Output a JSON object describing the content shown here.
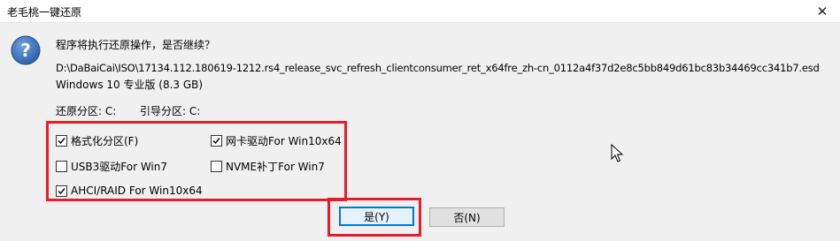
{
  "window": {
    "title": "老毛桃一键还原",
    "close_glyph": "✕"
  },
  "dialog": {
    "question": "程序将执行还原操作，是否继续？",
    "image_path": "D:\\DaBaiCai\\ISO\\17134.112.180619-1212.rs4_release_svc_refresh_clientconsumer_ret_x64fre_zh-cn_0112a4f37d2e8c5bb849d61bc83b34469cc341b7.esd",
    "image_info": "Windows 10 专业版 (8.3 GB)",
    "restore_partition": "还原分区: C:",
    "boot_partition": "引导分区: C:"
  },
  "options": [
    {
      "label": "格式化分区(F)",
      "checked": true
    },
    {
      "label": "网卡驱动For Win10x64",
      "checked": true
    },
    {
      "label": "USB3驱动For Win7",
      "checked": false
    },
    {
      "label": "NVME补丁For Win7",
      "checked": false
    },
    {
      "label": "AHCI/RAID For Win10x64",
      "checked": true
    }
  ],
  "buttons": {
    "yes": "是(Y)",
    "no": "否(N)"
  },
  "colors": {
    "highlight": "#e81c2a",
    "focus": "#0078d7",
    "icon": "#3a6fb0"
  }
}
